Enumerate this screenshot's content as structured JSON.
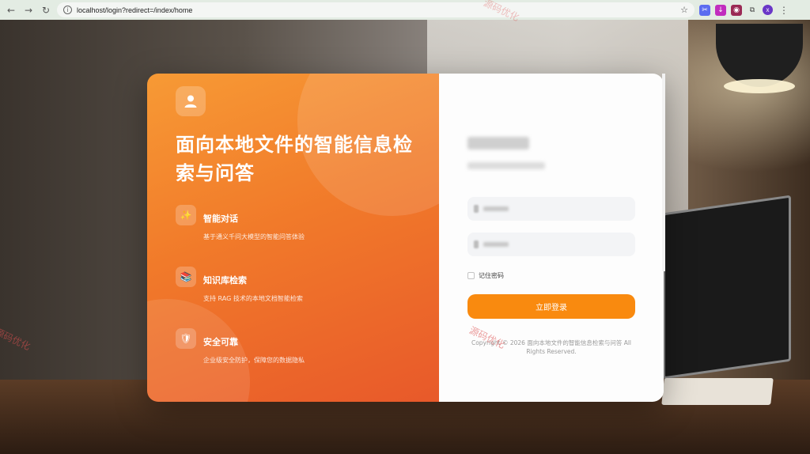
{
  "browser": {
    "url": "localhost/login?redirect=/index/home",
    "profile_initial": "x"
  },
  "hero": {
    "title": "面向本地文件的智能信息检索与问答",
    "features": [
      {
        "icon": "sparkles-icon",
        "glyph": "✨",
        "title": "智能对话",
        "desc": "基于通义千问大模型的智能问答体验"
      },
      {
        "icon": "books-icon",
        "glyph": "📚",
        "title": "知识库检索",
        "desc": "支持 RAG 技术的本地文档智能检索"
      },
      {
        "icon": "shield-icon",
        "glyph": "🛡",
        "title": "安全可靠",
        "desc": "企业级安全防护，保障您的数据隐私"
      }
    ]
  },
  "login": {
    "remember_label": "记住密码",
    "submit_label": "立即登录",
    "copyright": "Copyright © 2026 面向本地文件的智能信息检索与问答 All Rights Reserved."
  },
  "watermarks": [
    "源码优化",
    "源码优化",
    "源码优化"
  ],
  "colors": {
    "accent": "#f98a0f",
    "hero_start": "#f79a35",
    "hero_end": "#e8592a"
  }
}
